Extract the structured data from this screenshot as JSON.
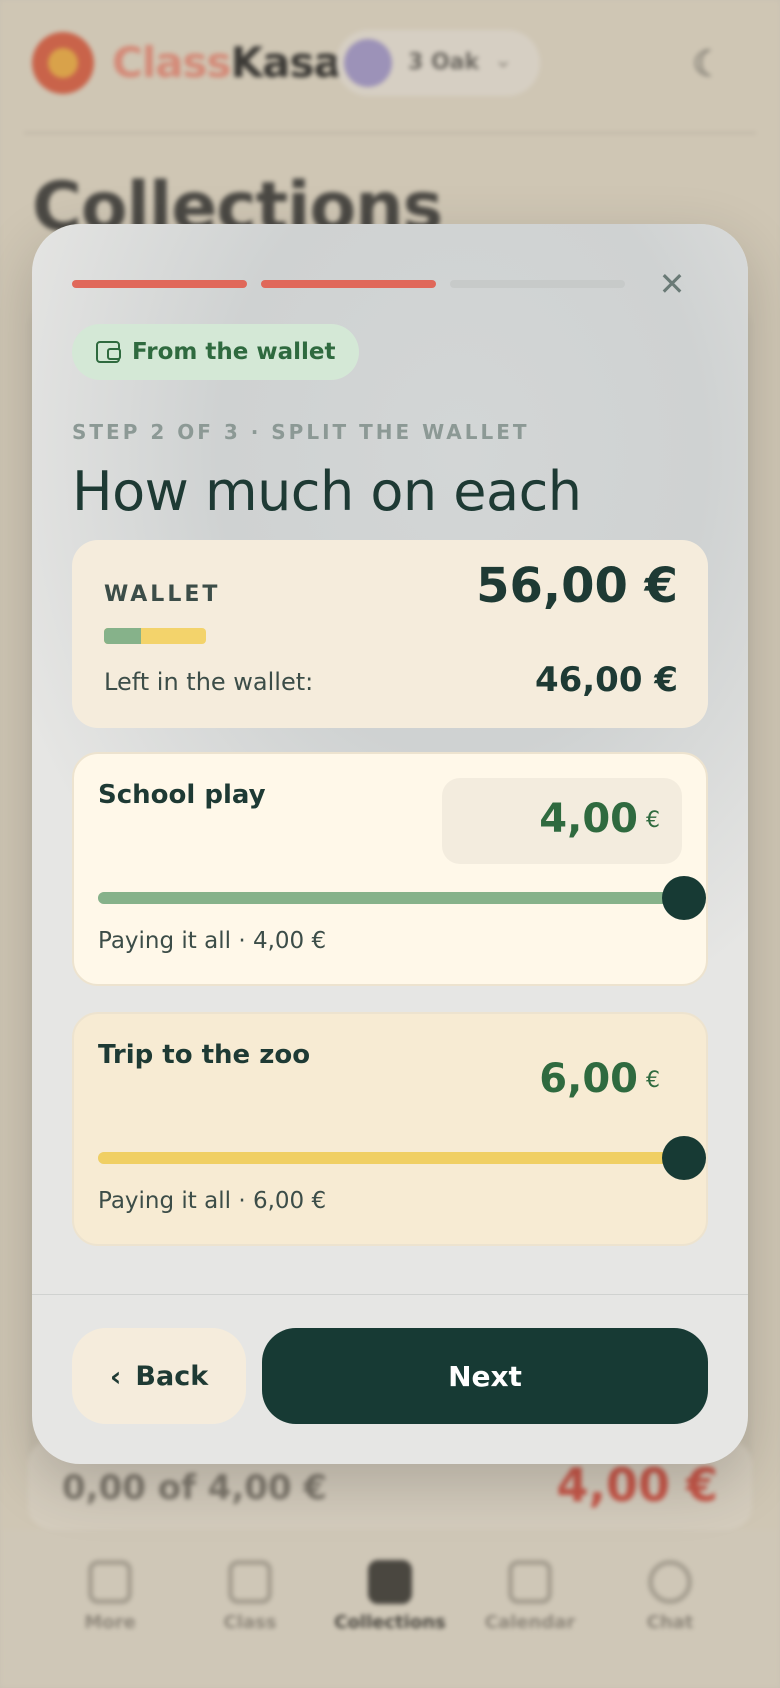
{
  "background": {
    "brand_part1": "Class",
    "brand_part2": "Kasa",
    "class_name": "3 Oak",
    "page_title": "Collections",
    "row_left": "0,00 of 4,00 €",
    "row_right": "4,00 €",
    "nav": [
      {
        "label": "More"
      },
      {
        "label": "Class"
      },
      {
        "label": "Collections"
      },
      {
        "label": "Calendar"
      },
      {
        "label": "Chat"
      }
    ]
  },
  "modal": {
    "progress": {
      "current_step": 2,
      "total_steps": 3
    },
    "close_icon": "close-icon",
    "source_chip": "From the wallet",
    "step_label": "STEP 2 OF 3 · SPLIT THE WALLET",
    "title": "How much on each",
    "wallet": {
      "label": "WALLET",
      "total": "56,00 €",
      "left_label": "Left in the wallet:",
      "left_value": "46,00 €",
      "used_fraction": 0.36
    },
    "allocations": [
      {
        "name": "School play",
        "amount": "4,00",
        "currency": "€",
        "status": "Paying it all · 4,00 €",
        "fill_fraction": 1.0
      },
      {
        "name": "Trip to the zoo",
        "amount": "6,00",
        "currency": "€",
        "status": "Paying it all · 6,00 €",
        "fill_fraction": 1.0
      }
    ],
    "back_label": "Back",
    "next_label": "Next"
  },
  "colors": {
    "accent_dark": "#173a34",
    "progress_done": "#e0685a",
    "slider_green": "#86b28a",
    "slider_yellow": "#f0cf63",
    "chip_green": "#2f6a3f"
  }
}
